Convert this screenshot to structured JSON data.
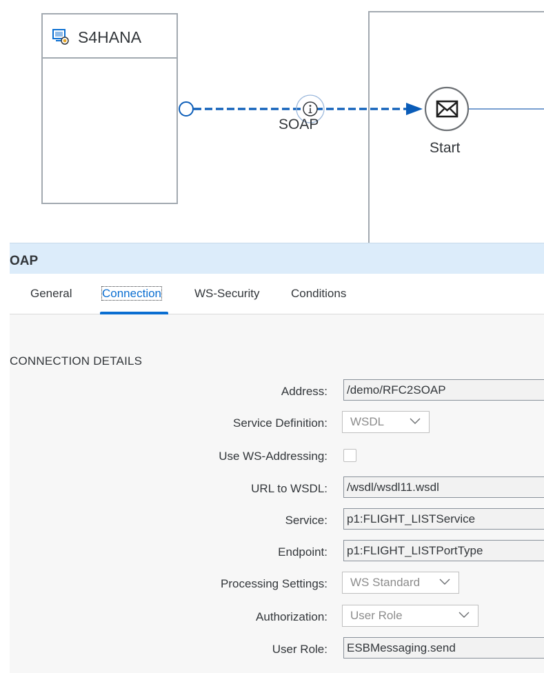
{
  "diagram": {
    "sender_title": "S4HANA",
    "connection_label": "SOAP",
    "start_label": "Start",
    "icons": {
      "sender": "system-participant-icon",
      "info": "info-circle-icon",
      "start": "envelope-icon"
    },
    "colors": {
      "edge": "#0a5cb8",
      "border": "#a2a9b0"
    }
  },
  "panel": {
    "title": "OAP",
    "tabs": [
      {
        "label": "General"
      },
      {
        "label": "Connection"
      },
      {
        "label": "WS-Security"
      },
      {
        "label": "Conditions"
      }
    ],
    "active_tab": "Connection",
    "section_title": "CONNECTION DETAILS",
    "fields": {
      "address": {
        "label": "Address:",
        "value": "/demo/RFC2SOAP"
      },
      "service_definition": {
        "label": "Service Definition:",
        "value": "WSDL"
      },
      "use_ws_addressing": {
        "label": "Use WS-Addressing:",
        "checked": false
      },
      "url_to_wsdl": {
        "label": "URL to WSDL:",
        "value": "/wsdl/wsdl11.wsdl"
      },
      "service": {
        "label": "Service:",
        "value": "p1:FLIGHT_LISTService"
      },
      "endpoint": {
        "label": "Endpoint:",
        "value": "p1:FLIGHT_LISTPortType"
      },
      "processing_settings": {
        "label": "Processing Settings:",
        "value": "WS Standard"
      },
      "authorization": {
        "label": "Authorization:",
        "value": "User Role"
      },
      "user_role": {
        "label": "User Role:",
        "value": "ESBMessaging.send"
      }
    },
    "colors": {
      "header_bg": "#dcecfa",
      "accent": "#0a6ed1"
    }
  }
}
